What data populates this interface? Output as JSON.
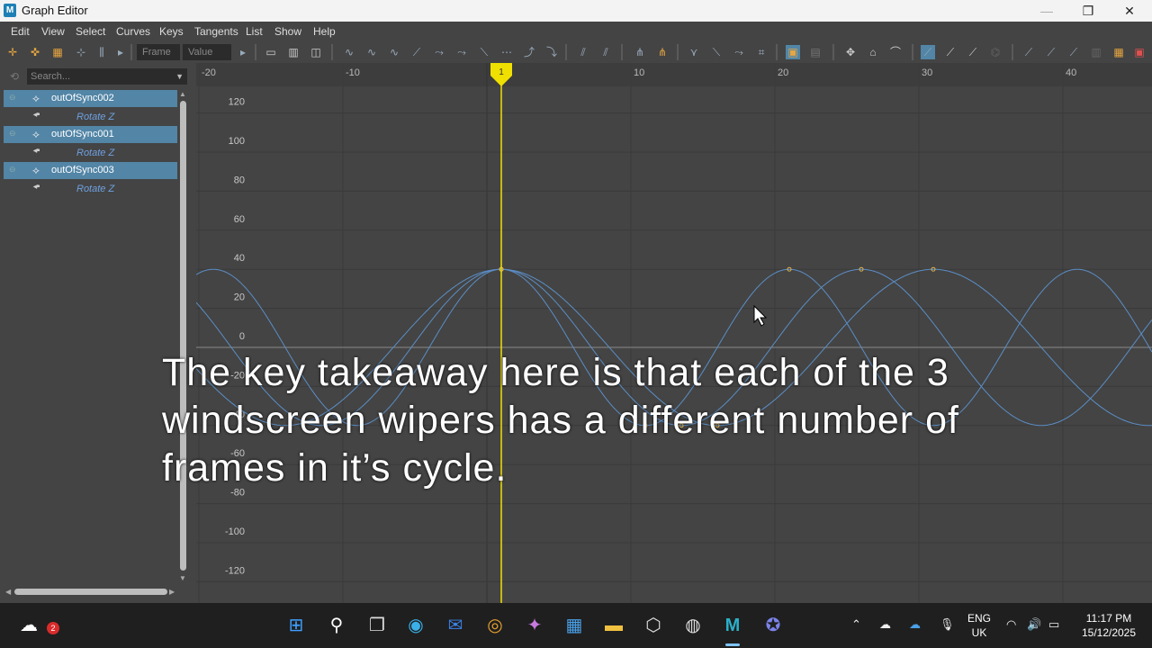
{
  "window": {
    "title": "Graph Editor",
    "minimize": "—",
    "maximize": "❐",
    "close": "✕"
  },
  "menu": [
    "Edit",
    "View",
    "Select",
    "Curves",
    "Keys",
    "Tangents",
    "List",
    "Show",
    "Help"
  ],
  "toolbar": {
    "frame_placeholder": "Frame",
    "value_placeholder": "Value"
  },
  "outliner": {
    "search_placeholder": "Search...",
    "rows": [
      {
        "type": "object",
        "label": "outOfSync002"
      },
      {
        "type": "attr",
        "label": "Rotate Z"
      },
      {
        "type": "object",
        "label": "outOfSync001"
      },
      {
        "type": "attr",
        "label": "Rotate Z"
      },
      {
        "type": "object",
        "label": "outOfSync003"
      },
      {
        "type": "attr",
        "label": "Rotate Z"
      }
    ]
  },
  "graph": {
    "current_frame": "1",
    "frame_labels": [
      "-20",
      "-10",
      "10",
      "20",
      "30",
      "40"
    ],
    "value_labels": [
      "120",
      "100",
      "80",
      "60",
      "40",
      "20",
      "0",
      "-20",
      "-40",
      "-60",
      "-80",
      "-100",
      "-120"
    ],
    "curve_color": "#5b8ec6",
    "key_color": "#e0b14a",
    "time_marker_color": "#f0e000",
    "curves": [
      {
        "name": "outOfSync001",
        "start_frame": 1,
        "period": 20,
        "amplitude": 40
      },
      {
        "name": "outOfSync002",
        "start_frame": 1,
        "period": 25,
        "amplitude": 40
      },
      {
        "name": "outOfSync003",
        "start_frame": 1,
        "period": 30,
        "amplitude": 40
      }
    ]
  },
  "subtitle": "The key takeaway here is that each of the 3 windscreen wipers has a different number of frames in it’s cycle.",
  "taskbar": {
    "weather_badge": "2",
    "lang_top": "ENG",
    "lang_bottom": "UK",
    "time": "11:17 PM",
    "date": "15/12/2025"
  }
}
